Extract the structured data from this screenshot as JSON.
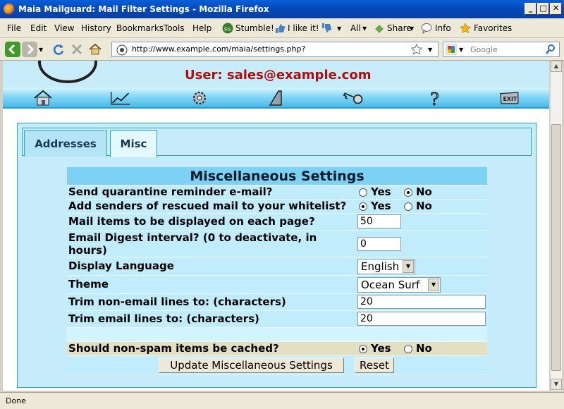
{
  "window": {
    "title": "Maia Mailguard: Mail Filter Settings - Mozilla Firefox"
  },
  "menu": {
    "items": [
      "File",
      "Edit",
      "View",
      "History",
      "Bookmarks",
      "Tools",
      "Help"
    ],
    "toolbar": {
      "stumble": "Stumble!",
      "ilike": "I like it!",
      "all": "All",
      "share": "Share",
      "info": "Info",
      "favorites": "Favorites"
    }
  },
  "nav": {
    "url": "http://www.example.com/maia/settings.php?",
    "search_placeholder": "Google"
  },
  "page": {
    "user_line": "User: sales@example.com",
    "tabs": [
      {
        "label": "Addresses",
        "active": false
      },
      {
        "label": "Misc",
        "active": true
      }
    ],
    "heading": "Miscellaneous Settings",
    "settings": {
      "reminder": {
        "label": "Send quarantine reminder e-mail?",
        "yes": "Yes",
        "no": "No",
        "selected": "No"
      },
      "whitelist": {
        "label": "Add senders of rescued mail to your whitelist?",
        "yes": "Yes",
        "no": "No",
        "selected": "Yes"
      },
      "items_per_page": {
        "label": "Mail items to be displayed on each page?",
        "value": "50"
      },
      "digest": {
        "label_line1": "Email Digest interval? (0 to deactivate, in",
        "label_line2": "hours)",
        "value": "0"
      },
      "language": {
        "label": "Display Language",
        "value": "English"
      },
      "theme": {
        "label": "Theme",
        "value": "Ocean Surf"
      },
      "trim_non_email": {
        "label": "Trim non-email lines to: (characters)",
        "value": "20"
      },
      "trim_email": {
        "label": "Trim email lines to: (characters)",
        "value": "20"
      },
      "cache": {
        "label": "Should non-spam items be cached?",
        "yes": "Yes",
        "no": "No",
        "selected": "Yes"
      }
    },
    "buttons": {
      "update": "Update Miscellaneous Settings",
      "reset": "Reset"
    }
  },
  "status": {
    "text": "Done"
  },
  "colors": {
    "user_red": "#aa1111",
    "panel_blue": "#c0ecfb",
    "heading_blue": "#7dd1f3",
    "highlight_yellow": "#e3dfc3"
  }
}
